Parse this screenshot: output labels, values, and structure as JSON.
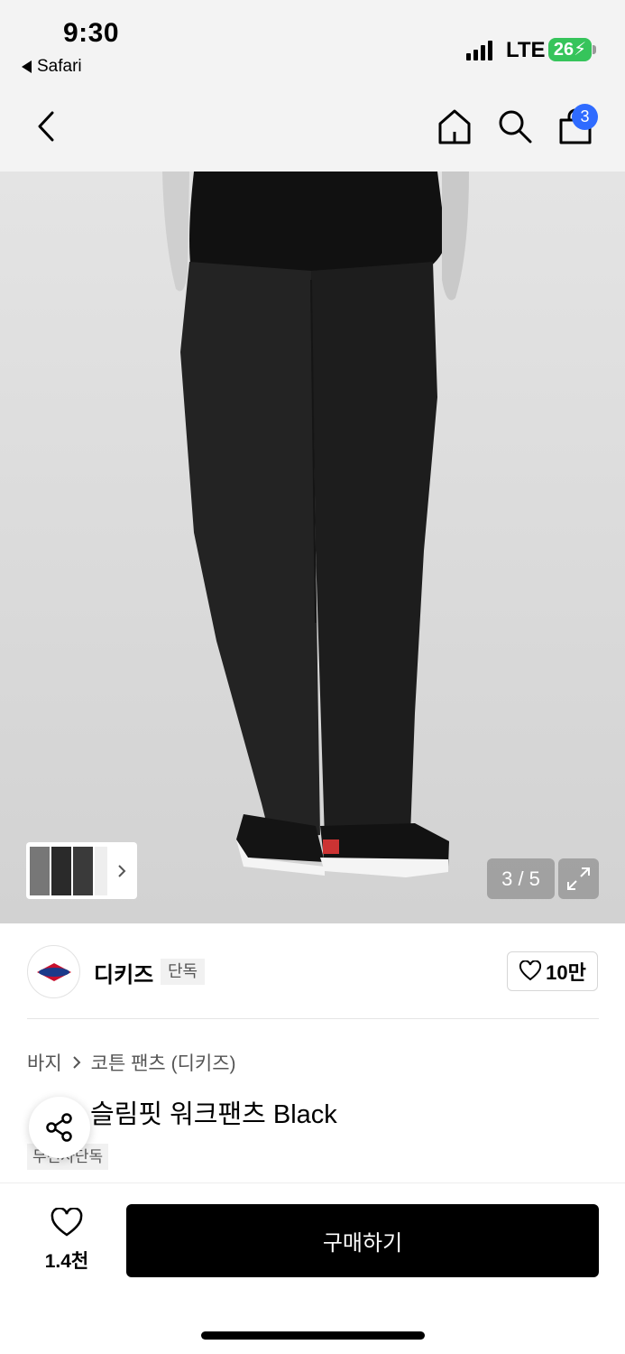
{
  "status_bar": {
    "time": "9:30",
    "back_app": "Safari",
    "network": "LTE",
    "battery": "26"
  },
  "nav": {
    "cart_count": "3",
    "icons": [
      "back-arrow-icon",
      "home-icon",
      "search-icon",
      "shopping-bag-icon"
    ]
  },
  "gallery": {
    "counter": "3 / 5"
  },
  "brand": {
    "name": "디키즈",
    "tag": "단독",
    "likes": "10만"
  },
  "product": {
    "breadcrumb": [
      "바지",
      "코튼 팬츠 (디키즈)"
    ],
    "title": "슬림핏 워크팬츠 Black",
    "exclusive_tag": "무신사단독"
  },
  "bottom_bar": {
    "wish_count": "1.4천",
    "buy_label": "구매하기"
  },
  "colors": {
    "accent_badge": "#2f6bff",
    "buy_button": "#000000"
  }
}
